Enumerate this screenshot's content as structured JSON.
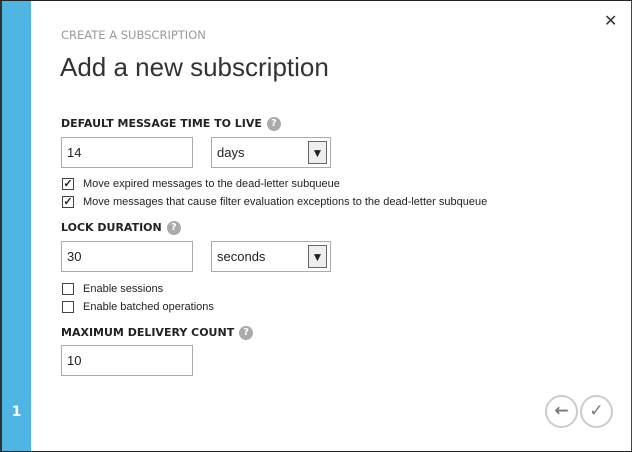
{
  "step": "1",
  "header": {
    "subtitle": "CREATE A SUBSCRIPTION",
    "title": "Add a new subscription"
  },
  "ttl": {
    "label": "DEFAULT MESSAGE TIME TO LIVE",
    "value": "14",
    "unit": "days"
  },
  "checks1": [
    {
      "label": "Move expired messages to the dead-letter subqueue",
      "checked": true
    },
    {
      "label": "Move messages that cause filter evaluation exceptions to the dead-letter subqueue",
      "checked": true
    }
  ],
  "lock": {
    "label": "LOCK DURATION",
    "value": "30",
    "unit": "seconds"
  },
  "checks2": [
    {
      "label": "Enable sessions",
      "checked": false
    },
    {
      "label": "Enable batched operations",
      "checked": false
    }
  ],
  "delivery": {
    "label": "MAXIMUM DELIVERY COUNT",
    "value": "10"
  },
  "icons": {
    "help": "?",
    "close": "✕",
    "back": "←",
    "ok": "✓",
    "check": "✓",
    "arrow": "▼"
  }
}
